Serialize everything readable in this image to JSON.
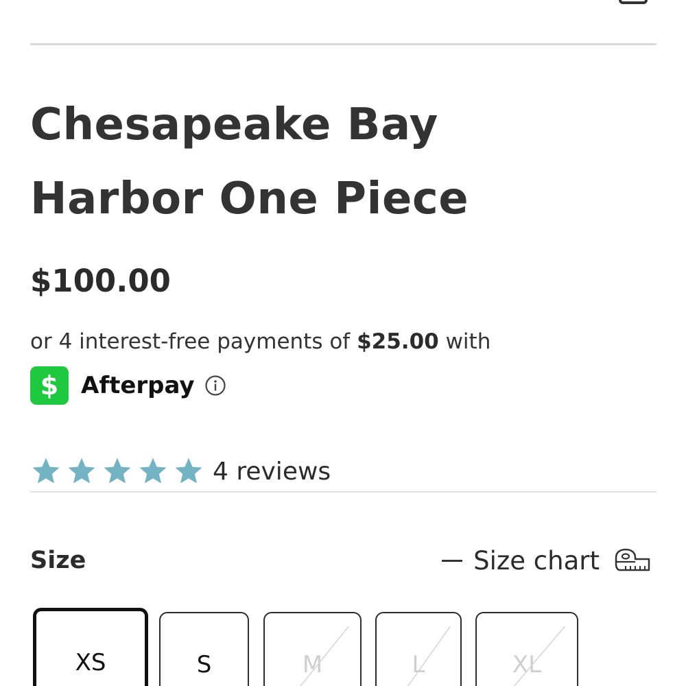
{
  "product": {
    "title_line1": "Chesapeake Bay",
    "title_line2": "Harbor One Piece",
    "price": "$100.00"
  },
  "payments": {
    "prefix": "or 4 interest-free payments of ",
    "amount": "$25.00",
    "suffix": " with",
    "provider_name": "Afterpay",
    "provider_logo_glyph": "$",
    "provider_logo_color": "#1ec940",
    "info_icon": "info-icon"
  },
  "rating": {
    "stars": 5,
    "max_stars": 5,
    "star_color": "#74b3c3",
    "reviews_label": "4 reviews"
  },
  "size": {
    "label": "Size",
    "chart_label": "Size chart",
    "chart_icon": "measuring-tape-icon",
    "options": [
      {
        "label": "XS",
        "selected": true,
        "available": true
      },
      {
        "label": "S",
        "selected": false,
        "available": true
      },
      {
        "label": "M",
        "selected": false,
        "available": false
      },
      {
        "label": "L",
        "selected": false,
        "available": false
      },
      {
        "label": "XL",
        "selected": false,
        "available": false
      }
    ]
  }
}
